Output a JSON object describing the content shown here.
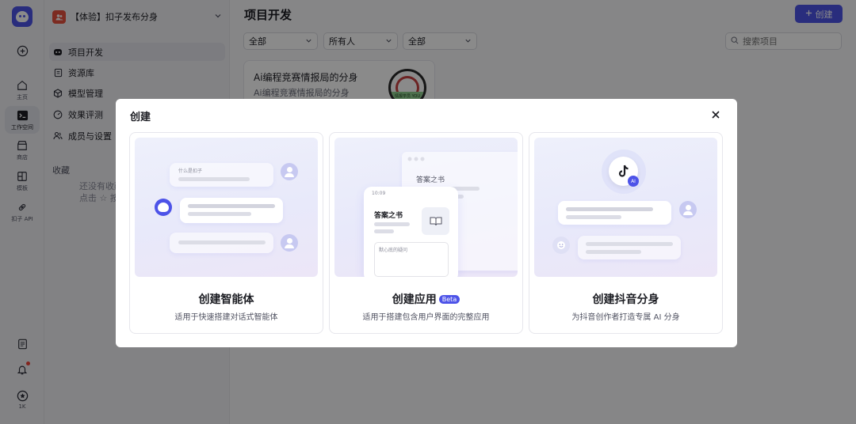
{
  "rail": {
    "items": [
      {
        "label": "主页",
        "icon": "home-icon"
      },
      {
        "label": "工作空间",
        "icon": "terminal-icon"
      },
      {
        "label": "商店",
        "icon": "store-icon"
      },
      {
        "label": "模板",
        "icon": "template-icon"
      },
      {
        "label": "扣子 API",
        "icon": "api-icon"
      }
    ],
    "bottom_count": "1K"
  },
  "panel": {
    "space_name": "【体验】扣子发布分身",
    "nav": [
      {
        "label": "项目开发",
        "icon": "bot-icon"
      },
      {
        "label": "资源库",
        "icon": "library-icon"
      },
      {
        "label": "模型管理",
        "icon": "cube-icon"
      },
      {
        "label": "效果评测",
        "icon": "gauge-icon"
      },
      {
        "label": "成员与设置",
        "icon": "members-icon"
      }
    ],
    "favorites_title": "收藏",
    "favorites_empty_line1": "还没有收藏",
    "favorites_empty_line2": "点击 ☆ 按钮"
  },
  "main": {
    "title": "项目开发",
    "create_label": "创建",
    "filters": [
      "全部",
      "所有人",
      "全部"
    ],
    "search_placeholder": "搜索项目",
    "project": {
      "title": "Ai编程竞赛情报局的分身",
      "desc": "Ai编程竞赛情报局的分身",
      "thumb_text": "情报学员 YOU"
    }
  },
  "modal": {
    "title": "创建",
    "options": [
      {
        "title": "创建智能体",
        "desc": "适用于快速搭建对话式智能体",
        "illus_text": "什么是扣子"
      },
      {
        "title": "创建应用",
        "badge": "Beta",
        "desc": "适用于搭建包含用户界面的完整应用",
        "illus_text": "答案之书",
        "illus_time": "10:09",
        "illus_input": "默心底的疑问"
      },
      {
        "title": "创建抖音分身",
        "desc": "为抖音创作者打造专属 AI 分身",
        "illus_badge": "AI"
      }
    ]
  },
  "colors": {
    "accent": "#4d53e8",
    "notify": "#f04438"
  }
}
